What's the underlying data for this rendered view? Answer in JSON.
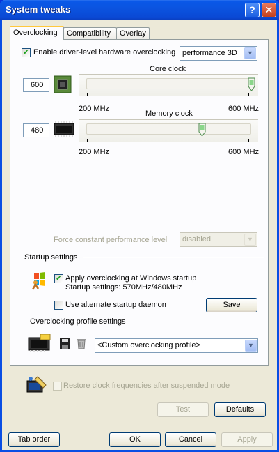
{
  "window": {
    "title": "System tweaks",
    "help_glyph": "?",
    "close_glyph": "✕"
  },
  "tabs": [
    {
      "label": "Overclocking",
      "active": true
    },
    {
      "label": "Compatibility",
      "active": false
    },
    {
      "label": "Overlay",
      "active": false
    }
  ],
  "overclocking": {
    "enable_checkbox_label": "Enable driver-level hardware overclocking",
    "enable_checked": true,
    "mode_select_value": "performance 3D",
    "core": {
      "label": "Core clock",
      "value": "600",
      "min_label": "200 MHz",
      "max_label": "600 MHz",
      "min": 200,
      "max": 600,
      "current": 600,
      "icon": "gpu-chip-icon"
    },
    "memory": {
      "label": "Memory clock",
      "value": "480",
      "min_label": "200 MHz",
      "max_label": "600 MHz",
      "min": 200,
      "max": 600,
      "current": 480,
      "icon": "memory-module-icon"
    },
    "force_level_label": "Force constant performance level",
    "force_level_value": "disabled"
  },
  "startup": {
    "section_label": "Startup settings",
    "apply_label": "Apply overclocking at Windows startup",
    "apply_checked": true,
    "startup_settings_text": "Startup settings: 570MHz/480MHz",
    "alternate_daemon_label": "Use alternate startup daemon",
    "alternate_checked": false,
    "save_button": "Save",
    "icon": "windows-startup-icon"
  },
  "profiles": {
    "section_label": "Overclocking profile settings",
    "profile_value": "<Custom overclocking profile>",
    "icons": [
      "memory-module-icon",
      "floppy-save-icon",
      "trash-icon"
    ]
  },
  "restore": {
    "label": "Restore clock frequencies after suspended mode",
    "checked": false,
    "icon": "card-restore-icon"
  },
  "buttons": {
    "test": "Test",
    "defaults": "Defaults",
    "tab_order": "Tab order",
    "ok": "OK",
    "cancel": "Cancel",
    "apply": "Apply"
  },
  "colors": {
    "title_bar": "#0a58e8",
    "dialog_bg": "#ece9d8",
    "tab_bg": "#fcfcfe",
    "check_green": "#21a121"
  }
}
